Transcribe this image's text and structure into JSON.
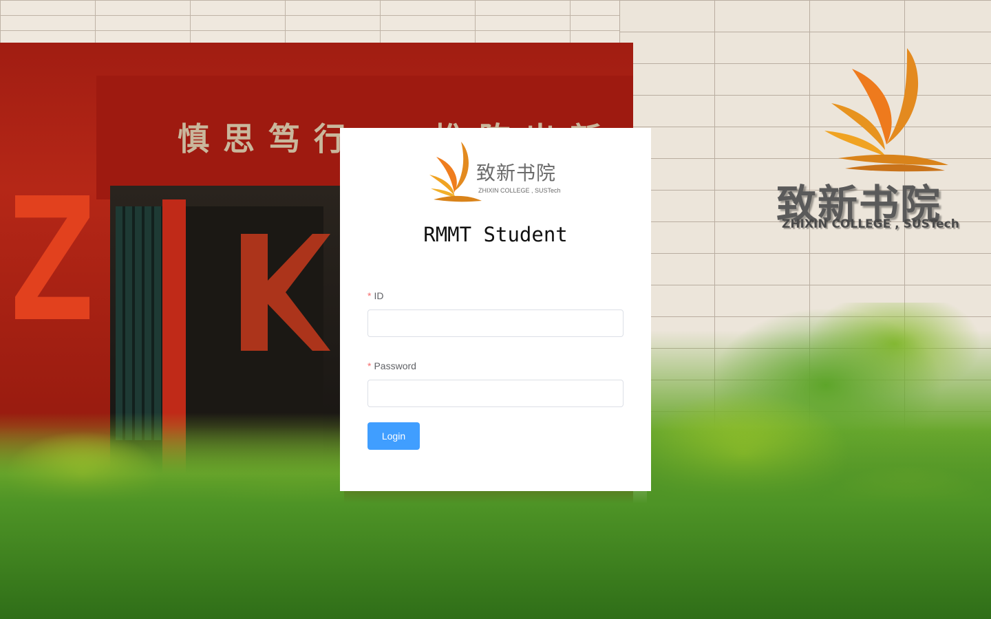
{
  "background": {
    "motto": "慎思笃行 · 推陈出新",
    "wall_logo": {
      "name_cn": "致新书院",
      "name_en": "ZHIXIN COLLEGE , SUSTech"
    }
  },
  "login": {
    "logo": {
      "name_cn": "致新书院",
      "name_en": "ZHIXIN COLLEGE , SUSTech"
    },
    "title": "RMMT Student",
    "id_field": {
      "required_mark": "*",
      "label": "ID",
      "value": ""
    },
    "password_field": {
      "required_mark": "*",
      "label": "Password",
      "value": ""
    },
    "login_label": "Login"
  },
  "colors": {
    "primary": "#409eff",
    "required": "#f56c6c",
    "label": "#606266",
    "border": "#dcdfe6",
    "logo_orange": "#e8891a"
  }
}
